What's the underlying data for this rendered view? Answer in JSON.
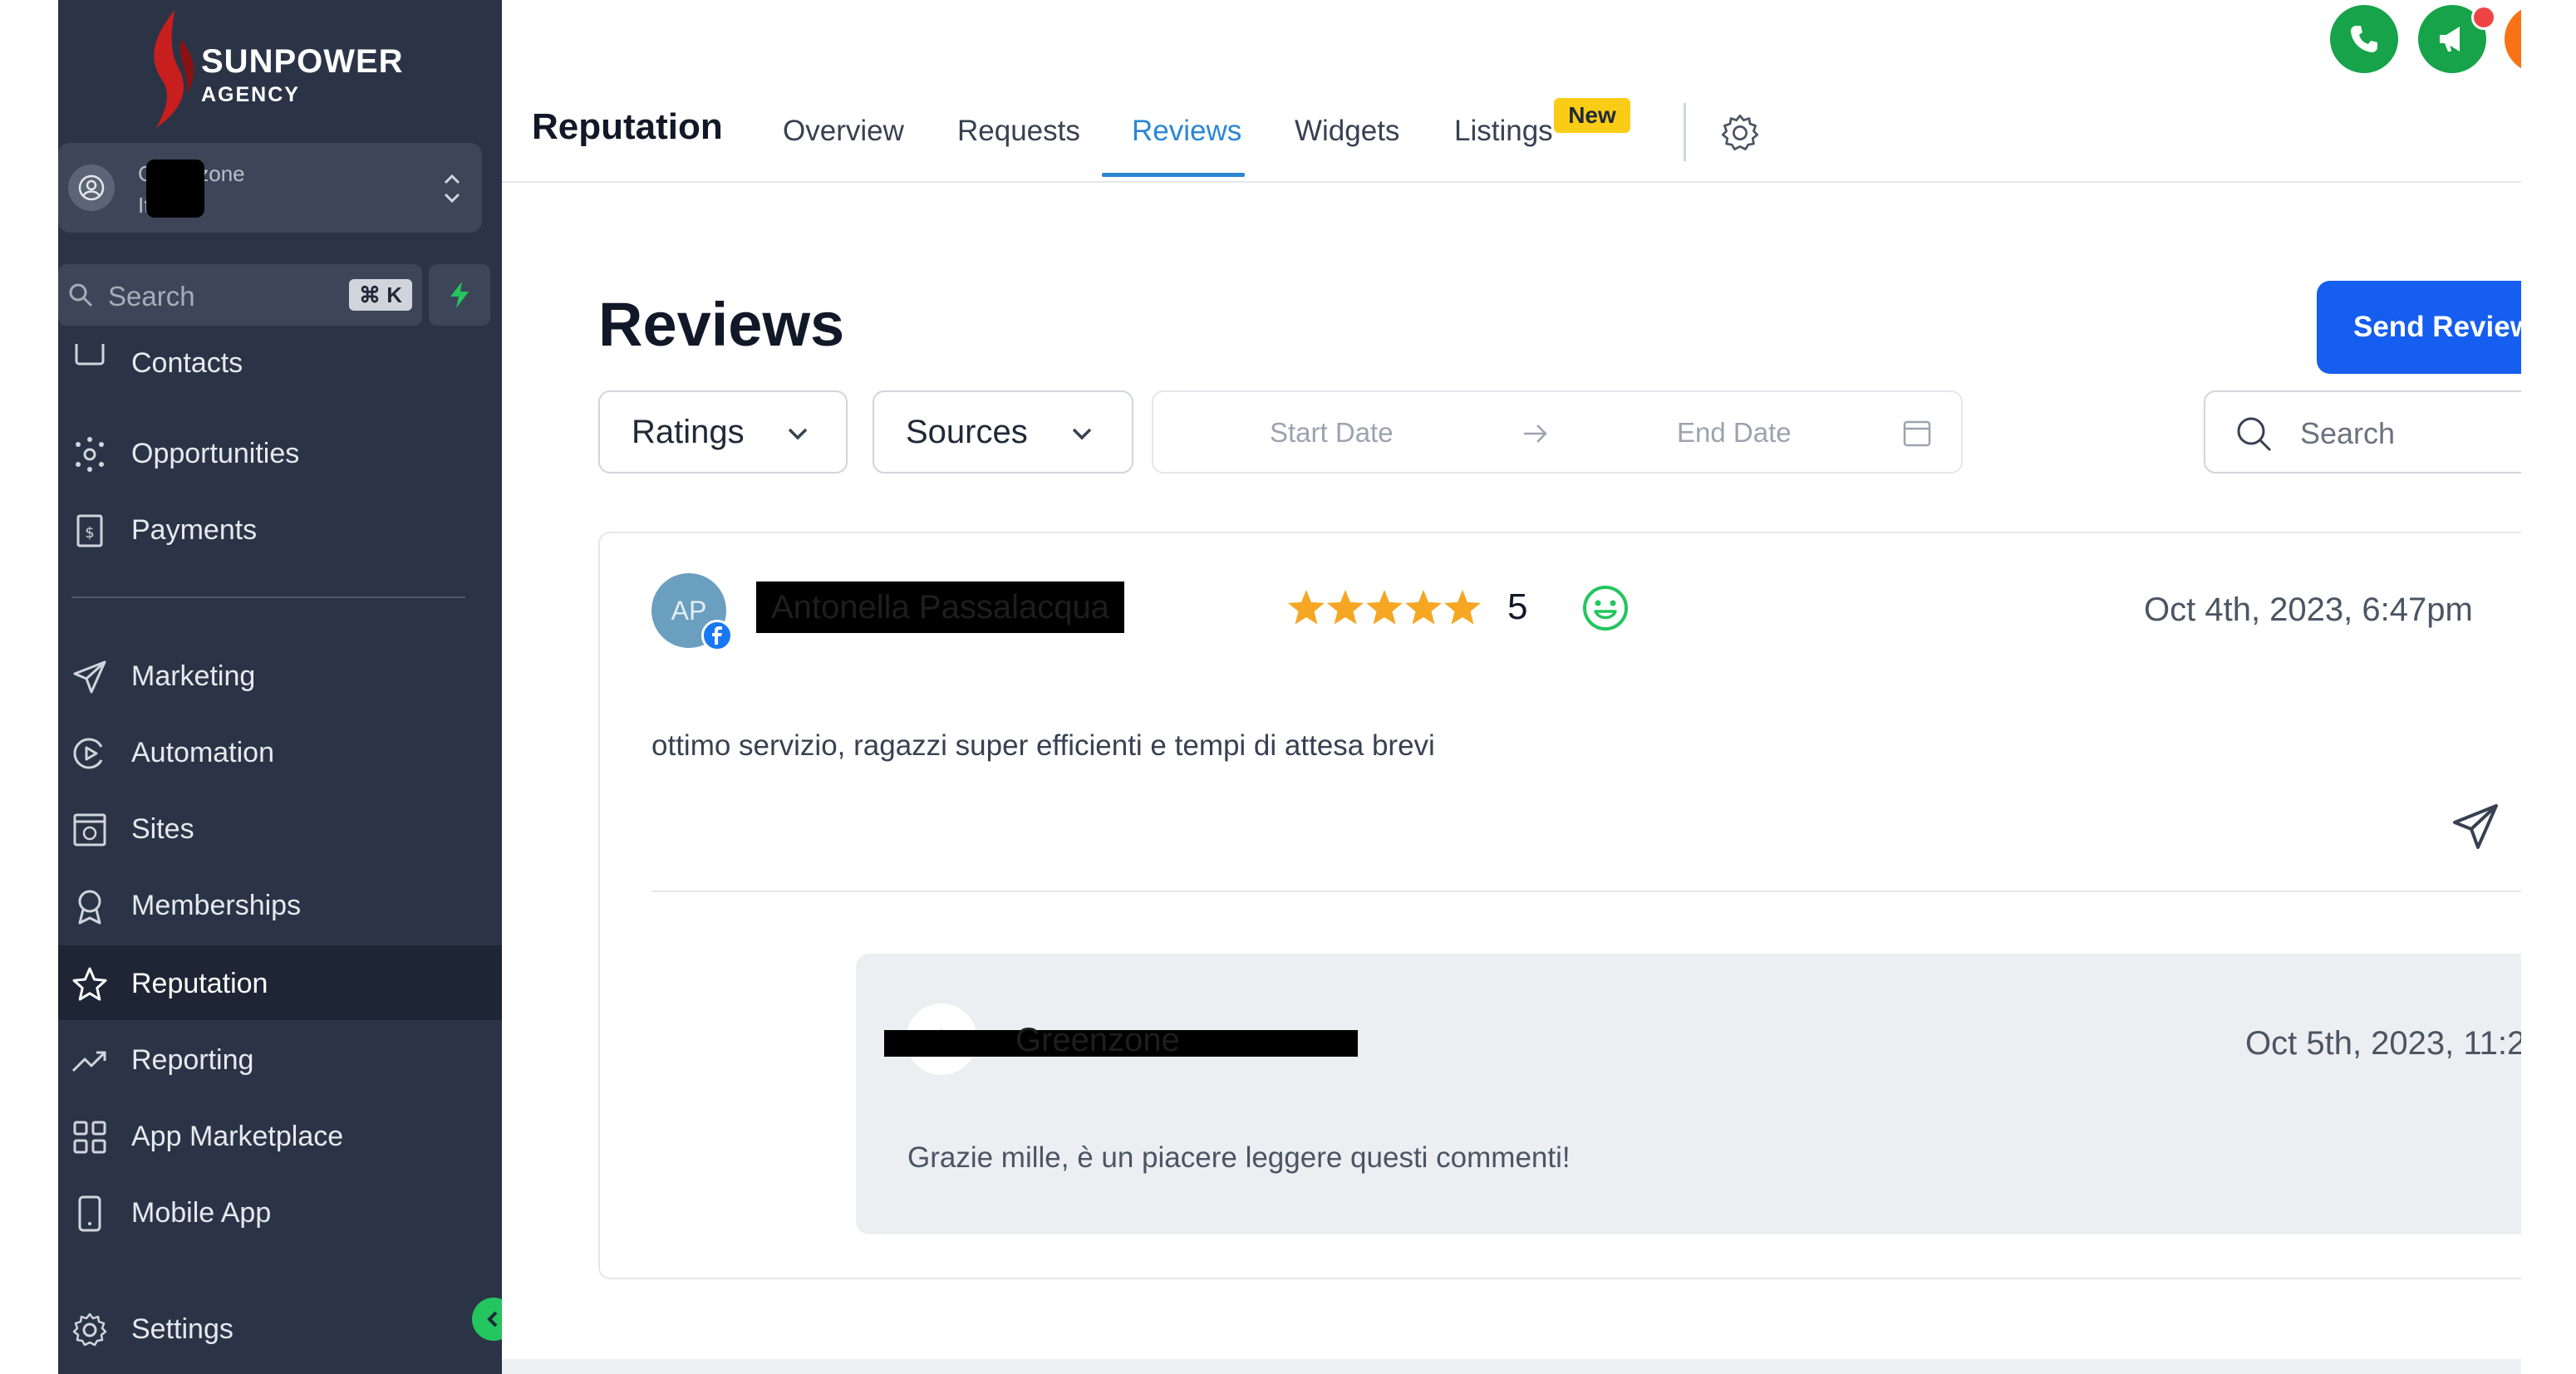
{
  "brand": {
    "name": "SUNPOWER",
    "sub": "AGENCY",
    "accent": "#c81e1e"
  },
  "account": {
    "name": "Greenzone",
    "location": "Italy"
  },
  "sidebar_search": {
    "label": "Search",
    "shortcut": "⌘ K"
  },
  "sidebar": {
    "items": [
      {
        "label": "Contacts",
        "icon": "contacts-icon"
      },
      {
        "label": "Opportunities",
        "icon": "opportunities-icon"
      },
      {
        "label": "Payments",
        "icon": "payments-icon"
      },
      {
        "label": "Marketing",
        "icon": "marketing-icon"
      },
      {
        "label": "Automation",
        "icon": "automation-icon"
      },
      {
        "label": "Sites",
        "icon": "sites-icon"
      },
      {
        "label": "Memberships",
        "icon": "memberships-icon"
      },
      {
        "label": "Reputation",
        "icon": "star-icon",
        "active": true
      },
      {
        "label": "Reporting",
        "icon": "reporting-icon"
      },
      {
        "label": "App Marketplace",
        "icon": "grid-icon"
      },
      {
        "label": "Mobile App",
        "icon": "mobile-icon"
      },
      {
        "label": "Settings",
        "icon": "gear-icon"
      }
    ]
  },
  "header": {
    "module": "Reputation",
    "tabs": [
      {
        "label": "Overview"
      },
      {
        "label": "Requests"
      },
      {
        "label": "Reviews",
        "active": true
      },
      {
        "label": "Widgets"
      },
      {
        "label": "Listings",
        "badge": "New"
      }
    ],
    "colors": {
      "active_tab": "#2b86d4",
      "badge": "#facc15",
      "call": "#16a34a"
    }
  },
  "page": {
    "title": "Reviews",
    "send_button": "Send Review"
  },
  "filters": {
    "ratings": "Ratings",
    "sources": "Sources",
    "start_placeholder": "Start Date",
    "end_placeholder": "End Date",
    "search_placeholder": "Search"
  },
  "review": {
    "initials": "AP",
    "author": "Antonella Passalacqua",
    "source_icon": "facebook-icon",
    "rating": 5,
    "rating_text": "5",
    "date": "Oct 4th, 2023, 6:47pm",
    "text": "ottimo servizio, ragazzi super efficienti e tempi di attesa brevi",
    "reply": {
      "author": "Greenzone",
      "date": "Oct 5th, 2023, 11:2",
      "text": "Grazie mille, è un piacere leggere questi commenti!"
    }
  }
}
